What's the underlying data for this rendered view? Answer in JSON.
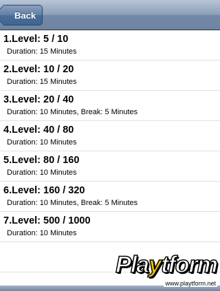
{
  "navbar": {
    "back_label": "Back"
  },
  "levels": [
    {
      "title": "1.Level: 5 / 10",
      "detail": "Duration: 15 Minutes"
    },
    {
      "title": "2.Level: 10 / 20",
      "detail": "Duration: 15 Minutes"
    },
    {
      "title": "3.Level: 20 / 40",
      "detail": "Duration: 10 Minutes, Break: 5 Minutes"
    },
    {
      "title": "4.Level: 40 / 80",
      "detail": "Duration: 10 Minutes"
    },
    {
      "title": "5.Level: 80 / 160",
      "detail": "Duration: 10 Minutes"
    },
    {
      "title": "6.Level: 160 / 320",
      "detail": "Duration: 10 Minutes, Break: 5 Minutes"
    },
    {
      "title": "7.Level: 500 / 1000",
      "detail": "Duration: 10 Minutes"
    }
  ],
  "watermark": {
    "logo_prefix": "Pla",
    "logo_y": "y",
    "logo_suffix": "tform",
    "url": "www.playtform.net"
  },
  "colors": {
    "navbar": "#6d84a2",
    "back_button": "#4a6d99",
    "separator": "#e0e0e0",
    "watermark_accent": "#f0c000"
  }
}
